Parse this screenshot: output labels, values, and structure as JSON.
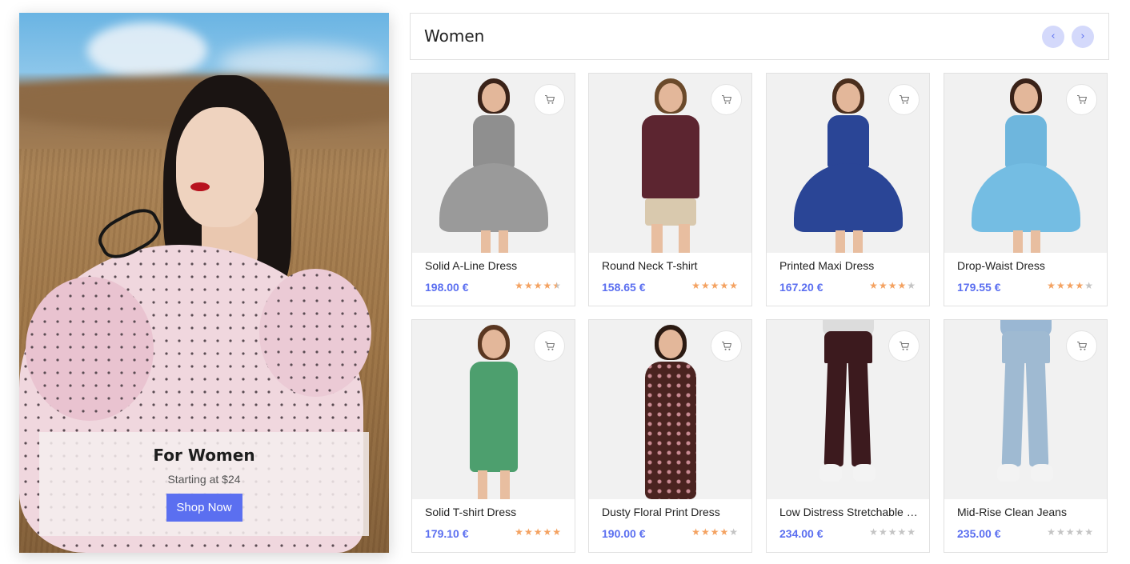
{
  "banner": {
    "title": "For Women",
    "subtitle": "Starting at $24",
    "button_label": "Shop Now"
  },
  "section": {
    "title": "Women",
    "prev_icon": "‹",
    "next_icon": "›"
  },
  "colors": {
    "accent": "#5b6ff0",
    "star": "#f4a261",
    "star_empty": "#c4c4c4"
  },
  "products": [
    {
      "name": "Solid A-Line Dress",
      "price": "198.00 €",
      "rating": 4.5,
      "icon": "cart-icon"
    },
    {
      "name": "Round Neck T-shirt",
      "price": "158.65 €",
      "rating": 5,
      "icon": "cart-icon"
    },
    {
      "name": "Printed Maxi Dress",
      "price": "167.20 €",
      "rating": 4,
      "icon": "cart-icon"
    },
    {
      "name": "Drop-Waist Dress",
      "price": "179.55 €",
      "rating": 4,
      "icon": "cart-icon"
    },
    {
      "name": "Solid T-shirt Dress",
      "price": "179.10 €",
      "rating": 5,
      "icon": "cart-icon"
    },
    {
      "name": "Dusty Floral Print Dress",
      "price": "190.00 €",
      "rating": 4,
      "icon": "cart-icon"
    },
    {
      "name": "Low Distress Stretchable Jeans",
      "price": "234.00 €",
      "rating": 0,
      "icon": "cart-icon"
    },
    {
      "name": "Mid-Rise Clean Jeans",
      "price": "235.00 €",
      "rating": 0,
      "icon": "cart-icon"
    }
  ]
}
